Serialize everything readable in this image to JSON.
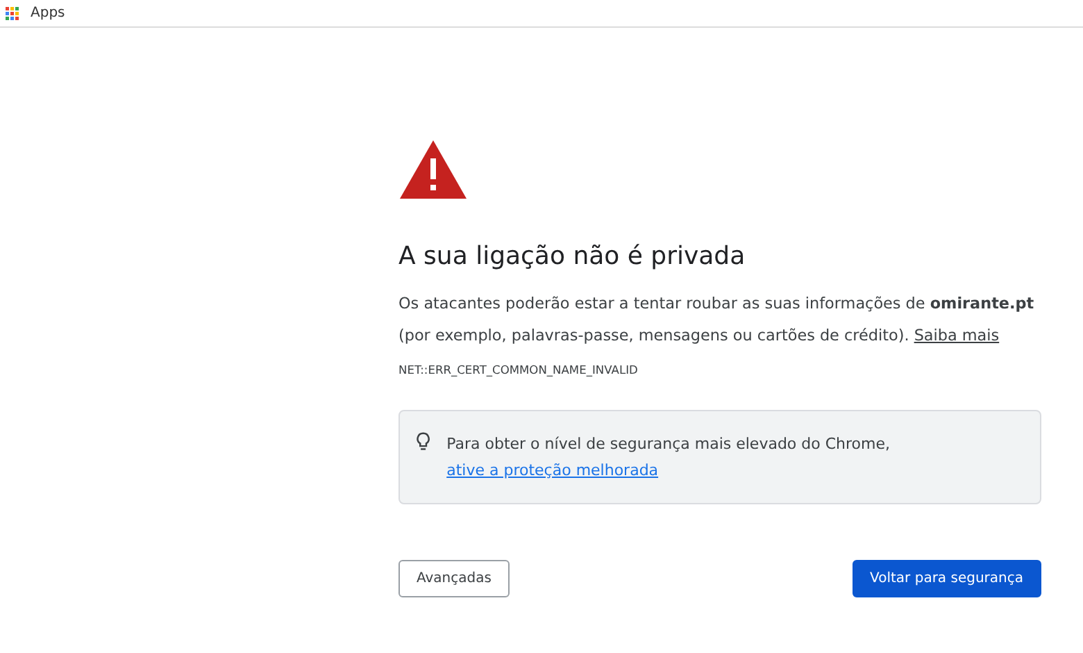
{
  "bookmarks_bar": {
    "items": [
      {
        "label": "Apps"
      }
    ]
  },
  "title": "A sua ligação não é privada",
  "explanation": {
    "text": "Os atacantes poderão estar a tentar roubar as suas informações de **omirante.pt** (por exemplo, palavras-passe, mensagens ou cartões de crédito). ",
    "link": "Saiba mais"
  },
  "error_code": "NET::ERR_CERT_COMMON_NAME_INVALID",
  "tip": {
    "text": "Para obter o nível de segurança mais elevado do Chrome, ",
    "link": "ative a proteção melhorada"
  },
  "buttons": [
    {
      "label": "Avançadas",
      "kind": "secondary"
    },
    {
      "label": "Voltar para segurança",
      "kind": "primary"
    }
  ]
}
